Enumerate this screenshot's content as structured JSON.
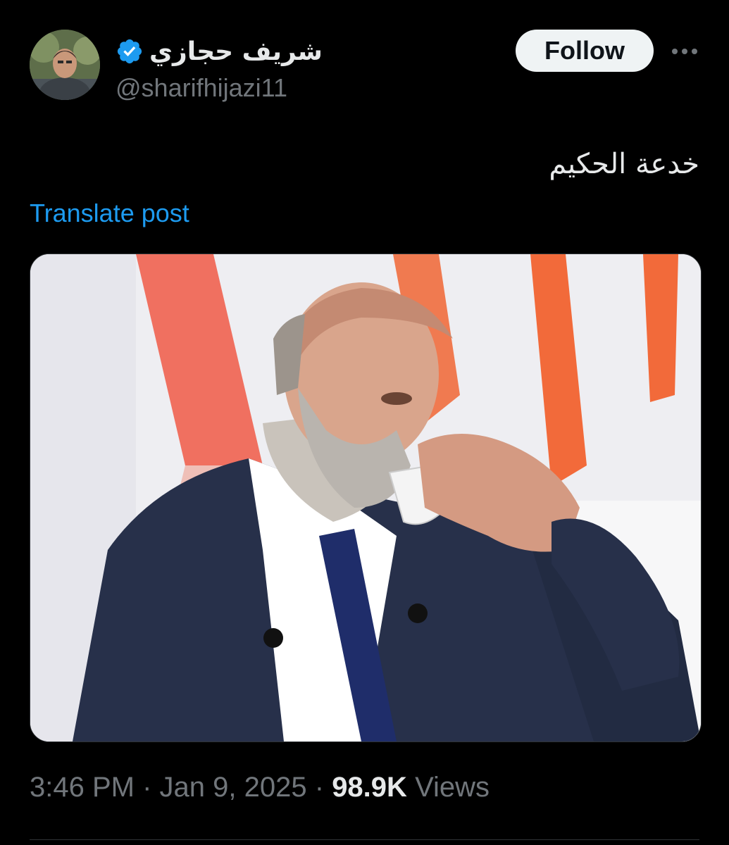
{
  "author": {
    "display_name": "شريف حجازي",
    "handle": "@sharifhijazi11",
    "verified": true
  },
  "header": {
    "follow_label": "Follow",
    "more_icon": "more-horizontal-icon"
  },
  "post": {
    "text": "خدعة الحكيم",
    "translate_label": "Translate post"
  },
  "meta": {
    "time": "3:46 PM",
    "separator": "·",
    "date": "Jan 9, 2025",
    "views_count": "98.9K",
    "views_label": "Views"
  },
  "colors": {
    "background": "#000000",
    "link": "#1d9bf0",
    "verified": "#1d9bf0",
    "secondary_text": "#71767b",
    "primary_text": "#e7e9ea",
    "follow_button_bg": "#eff3f4"
  }
}
